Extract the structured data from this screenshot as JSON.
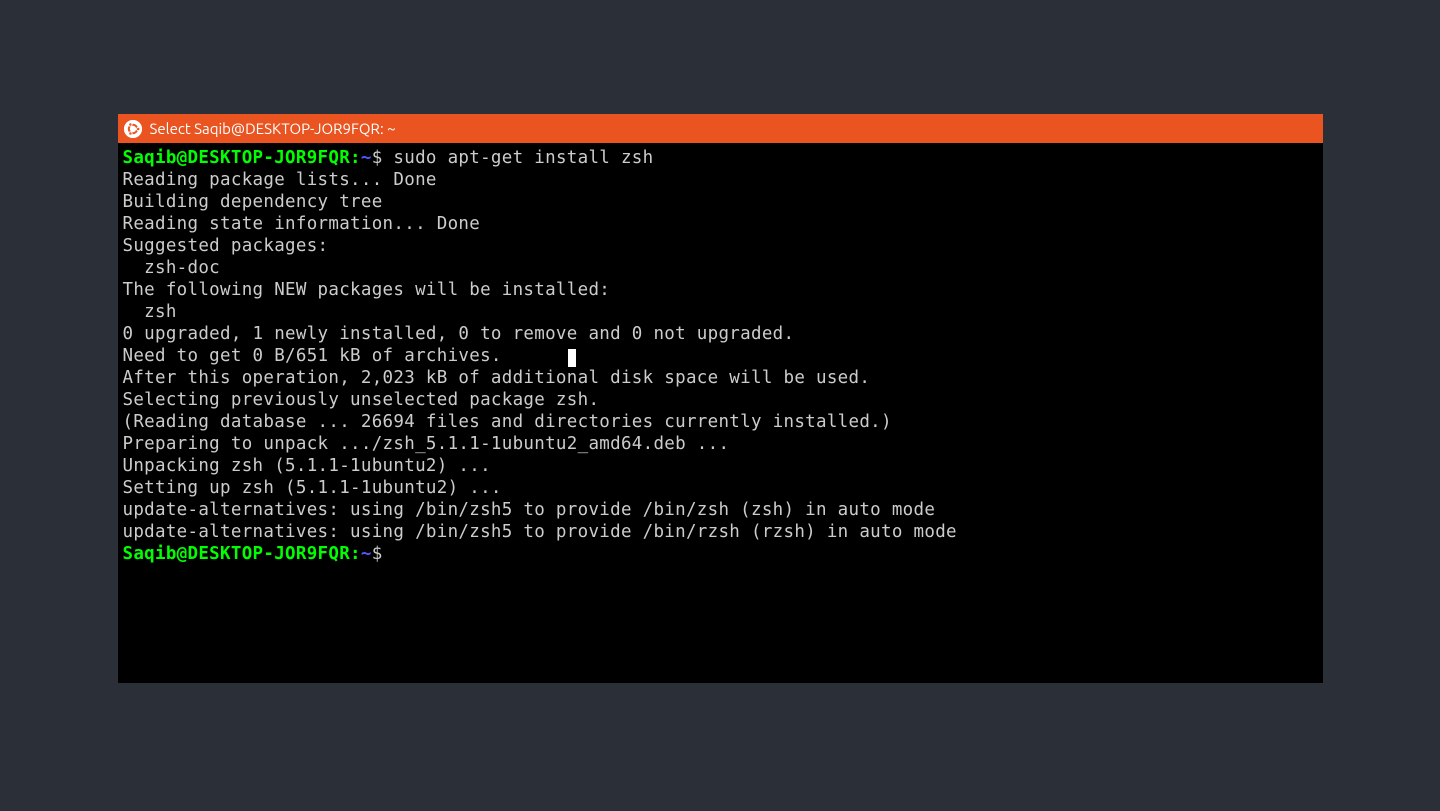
{
  "titlebar": {
    "title": "Select Saqib@DESKTOP-JOR9FQR: ~"
  },
  "terminal": {
    "prompt1": {
      "user_host": "Saqib@DESKTOP-JOR9FQR:",
      "tilde": "~",
      "dollar": "$",
      "command": " sudo apt-get install zsh"
    },
    "lines": [
      "Reading package lists... Done",
      "Building dependency tree",
      "Reading state information... Done",
      "Suggested packages:",
      "  zsh-doc",
      "The following NEW packages will be installed:",
      "  zsh",
      "0 upgraded, 1 newly installed, 0 to remove and 0 not upgraded.",
      "Need to get 0 B/651 kB of archives.",
      "After this operation, 2,023 kB of additional disk space will be used.",
      "Selecting previously unselected package zsh.",
      "(Reading database ... 26694 files and directories currently installed.)",
      "Preparing to unpack .../zsh_5.1.1-1ubuntu2_amd64.deb ...",
      "Unpacking zsh (5.1.1-1ubuntu2) ...",
      "Setting up zsh (5.1.1-1ubuntu2) ...",
      "update-alternatives: using /bin/zsh5 to provide /bin/zsh (zsh) in auto mode",
      "update-alternatives: using /bin/zsh5 to provide /bin/rzsh (rzsh) in auto mode"
    ],
    "prompt2": {
      "user_host": "Saqib@DESKTOP-JOR9FQR:",
      "tilde": "~",
      "dollar": "$"
    }
  }
}
